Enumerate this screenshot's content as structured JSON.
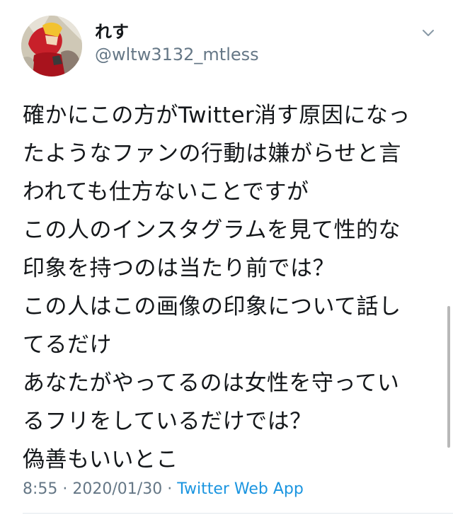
{
  "user": {
    "display_name": "れす",
    "handle": "@wltw3132_mtless",
    "avatar_icon": "avatar-image"
  },
  "tweet": {
    "lines": [
      "確かにこの方がTwitter消す原因になっ",
      "たようなファンの行動は嫌がらせと言",
      "われても仕方ないことですが",
      "この人のインスタグラムを見て性的な",
      "印象を持つのは当たり前では？",
      "この人はこの画像の印象について話し",
      "てるだけ",
      "あなたがやってるのは女性を守ってい",
      "るフリをしているだけでは？",
      "偽善もいいとこ"
    ]
  },
  "meta": {
    "time": "8:55",
    "separator1": " · ",
    "date": "2020/01/30",
    "separator2": " · ",
    "source": "Twitter Web App"
  },
  "colors": {
    "text": "#14171a",
    "secondary": "#657786",
    "link": "#1b95e0"
  }
}
